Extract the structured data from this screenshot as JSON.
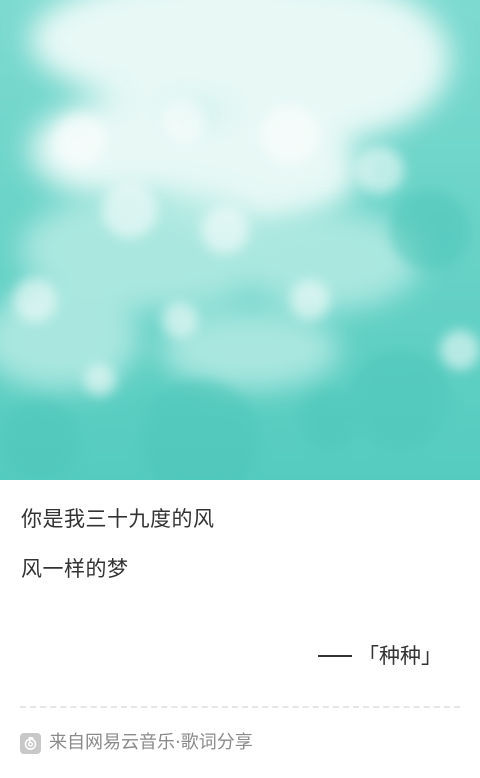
{
  "share_card": {
    "cover": {
      "colors": {
        "base": "#5fd0c4",
        "light": "#a8e8e0",
        "cloud": "#eefaf8"
      }
    },
    "lyrics": [
      "你是我三十九度的风",
      "风一样的梦"
    ],
    "song_title": "「种种」",
    "footer": {
      "logo_icon": "netease-cloud-music-logo",
      "text": "来自网易云音乐·歌词分享"
    }
  }
}
